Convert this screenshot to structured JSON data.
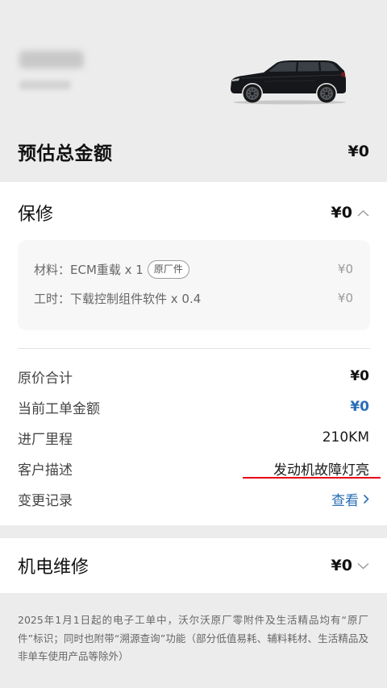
{
  "hero": {
    "total_label": "预估总金额",
    "total_value": "¥0"
  },
  "warranty": {
    "title": "保修",
    "amount": "¥0",
    "items": [
      {
        "label": "材料：ECM重载 x 1",
        "badge": "原厂件",
        "price": "¥0"
      },
      {
        "label": "工时：下载控制组件软件 x 0.4",
        "price": "¥0"
      }
    ],
    "summary": [
      {
        "label": "原价合计",
        "value": "¥0"
      },
      {
        "label": "当前工单金额",
        "value": "¥0"
      },
      {
        "label": "进厂里程",
        "value": "210KM"
      },
      {
        "label": "客户描述",
        "value": "发动机故障灯亮"
      },
      {
        "label": "变更记录",
        "value": "查看"
      }
    ]
  },
  "electromech": {
    "title": "机电维修",
    "amount": "¥0"
  },
  "footer": {
    "notice": "2025年1月1日起的电子工单中，沃尔沃原厂零附件及生活精品均有“原厂件”标识；同时也附带“溯源查询”功能（部分低值易耗、辅料耗材、生活精品及非单车使用产品等除外）"
  },
  "colors": {
    "page_background": "#ececec",
    "card_background": "#ffffff",
    "accent_blue": "#2a6fb5",
    "annotation_red": "#e60012"
  },
  "icons": {
    "warranty_toggle": "chevron-up-icon",
    "electromech_toggle": "chevron-down-icon",
    "view_link": "chevron-right-icon",
    "vehicle": "vehicle-image"
  }
}
